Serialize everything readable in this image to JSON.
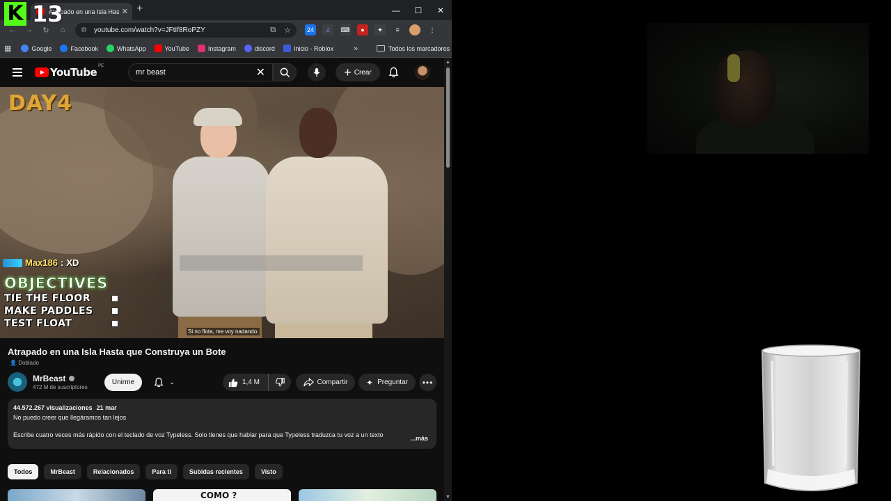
{
  "overlay": {
    "streamer_badge": "K",
    "level": "13"
  },
  "browser": {
    "tab_title": "Atrapado en una Isla Hasta que Construya un Bote",
    "url": "youtube.com/watch?v=JFtIf8RoPZY",
    "bookmarks": [
      {
        "label": "Google",
        "color": "#4285f4"
      },
      {
        "label": "Facebook",
        "color": "#1877f2"
      },
      {
        "label": "WhatsApp",
        "color": "#25d366"
      },
      {
        "label": "YouTube",
        "color": "#ff0000"
      },
      {
        "label": "Instagram",
        "color": "#e1306c"
      },
      {
        "label": "discord",
        "color": "#5865f2"
      },
      {
        "label": "Inicio - Roblox",
        "color": "#3b5bdb"
      }
    ],
    "all_bookmarks": "Todos los marcadores",
    "extension_badge": "24"
  },
  "youtube": {
    "logo": "YouTube",
    "country": "PE",
    "search_query": "mr beast",
    "create_label": "Crear",
    "video": {
      "overlay_day": "DAY4",
      "chat_user": "Max186",
      "chat_sep": ":",
      "chat_message": "XD",
      "objectives_title": "OBJECTIVES",
      "objectives": [
        "TIE THE FLOOR",
        "MAKE PADDLES",
        "TEST FLOAT"
      ],
      "subtitle": "Si no flota, me voy nadando."
    },
    "title": "Atrapado en una Isla Hasta que Construya un Bote",
    "dubbed": "Doblado",
    "channel": {
      "name": "MrBeast",
      "subscribers": "472 M de suscriptores"
    },
    "join_label": "Unirme",
    "likes": "1,4 M",
    "share_label": "Compartir",
    "ask_label": "Preguntar",
    "description": {
      "views": "44.572.267 visualizaciones",
      "date": "21 mar",
      "line1": "No puedo creer que llegáramos tan lejos",
      "line2": "Escribe cuatro veces más rápido con el teclado de voz Typeless. Solo tienes que hablar para que Typeless traduzca tu voz a un texto",
      "more": "...más"
    },
    "chips": [
      "Todos",
      "MrBeast",
      "Relacionados",
      "Para ti",
      "Subidas recientes",
      "Visto"
    ],
    "thumb_text": "COMO ?"
  }
}
